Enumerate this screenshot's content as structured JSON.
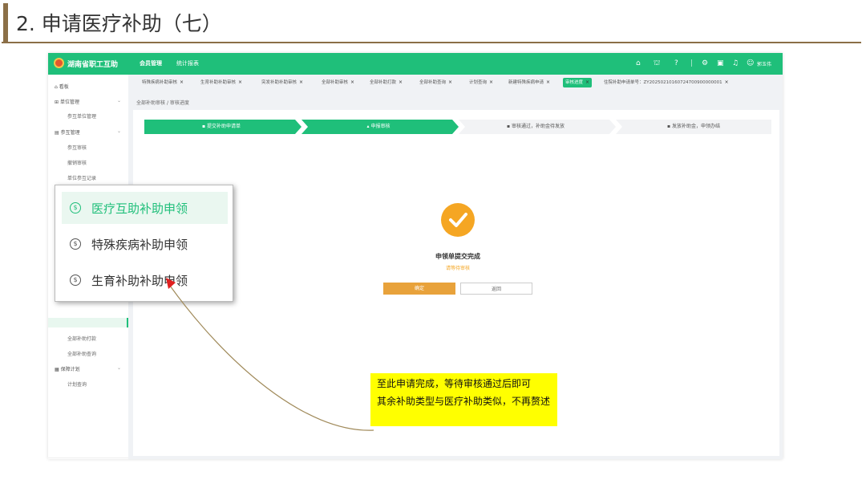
{
  "slide": {
    "title": "2. 申请医疗补助（七）"
  },
  "app": {
    "name": "湖南省职工互助",
    "nav": [
      "会员管理",
      "统计报表"
    ],
    "user": "郭玉伟",
    "topbar_icons": [
      "home-icon",
      "bank-icon",
      "help-icon",
      "settings-icon",
      "message-icon",
      "bell-icon",
      "user-icon"
    ]
  },
  "sidebar": {
    "items": [
      {
        "label": "看板",
        "icon": "dashboard-icon"
      },
      {
        "label": "单位管理",
        "icon": "unit-icon",
        "children": [
          "参互单位管理"
        ]
      },
      {
        "label": "参互管理",
        "icon": "member-icon",
        "children": [
          "参互审核",
          "撤销审核",
          "单位参互记录"
        ]
      },
      {
        "label": "全部补助打款"
      },
      {
        "label": "全部补助查询"
      },
      {
        "label": "保障计划",
        "icon": "plan-icon",
        "children": [
          "计划查询"
        ]
      }
    ]
  },
  "tabs": [
    {
      "label": "特殊疾病补助审核"
    },
    {
      "label": "生育补助补助审核"
    },
    {
      "label": "突发补助补助审核"
    },
    {
      "label": "全部补助审核"
    },
    {
      "label": "全部补助打款"
    },
    {
      "label": "全部补助查询"
    },
    {
      "label": "计划查询"
    },
    {
      "label": "新建特殊疾病申请"
    },
    {
      "label": "审核进度",
      "active": true
    },
    {
      "label": "住院补助申请单号：ZY20250210160724700900000001"
    }
  ],
  "breadcrumb": {
    "parent": "全部补助审核",
    "current": "审核进度"
  },
  "steps": [
    {
      "label": "提交补助申请单",
      "icon": "doc-icon",
      "done": true
    },
    {
      "label": "申报审核",
      "icon": "person-icon",
      "done": true
    },
    {
      "label": "审核通过，补助金待发放",
      "icon": "doc-icon",
      "done": false
    },
    {
      "label": "发放补助金，申领办结",
      "icon": "money-icon",
      "done": false
    }
  ],
  "result": {
    "title": "申领单提交完成",
    "subtitle": "请等待审核",
    "confirm_label": "确定",
    "back_label": "返回"
  },
  "popup": {
    "items": [
      {
        "label": "医疗互助补助申领",
        "icon": "money-circle-icon",
        "highlight": true
      },
      {
        "label": "特殊疾病补助申领",
        "icon": "money-circle-icon",
        "highlight": false
      },
      {
        "label": "生育补助补助申领",
        "icon": "money-circle-icon",
        "highlight": false
      }
    ]
  },
  "note": {
    "line1": "至此申请完成，等待审核通过后即可",
    "line2": "其余补助类型与医疗补助类似，不再赘述"
  },
  "colors": {
    "brand": "#1fbf7a",
    "accent": "#f5a623",
    "title_bar": "#8b6f47",
    "note_bg": "#ffff00",
    "annotation_arrow": "#a08a5a",
    "annotation_arrowhead": "#e02020"
  }
}
